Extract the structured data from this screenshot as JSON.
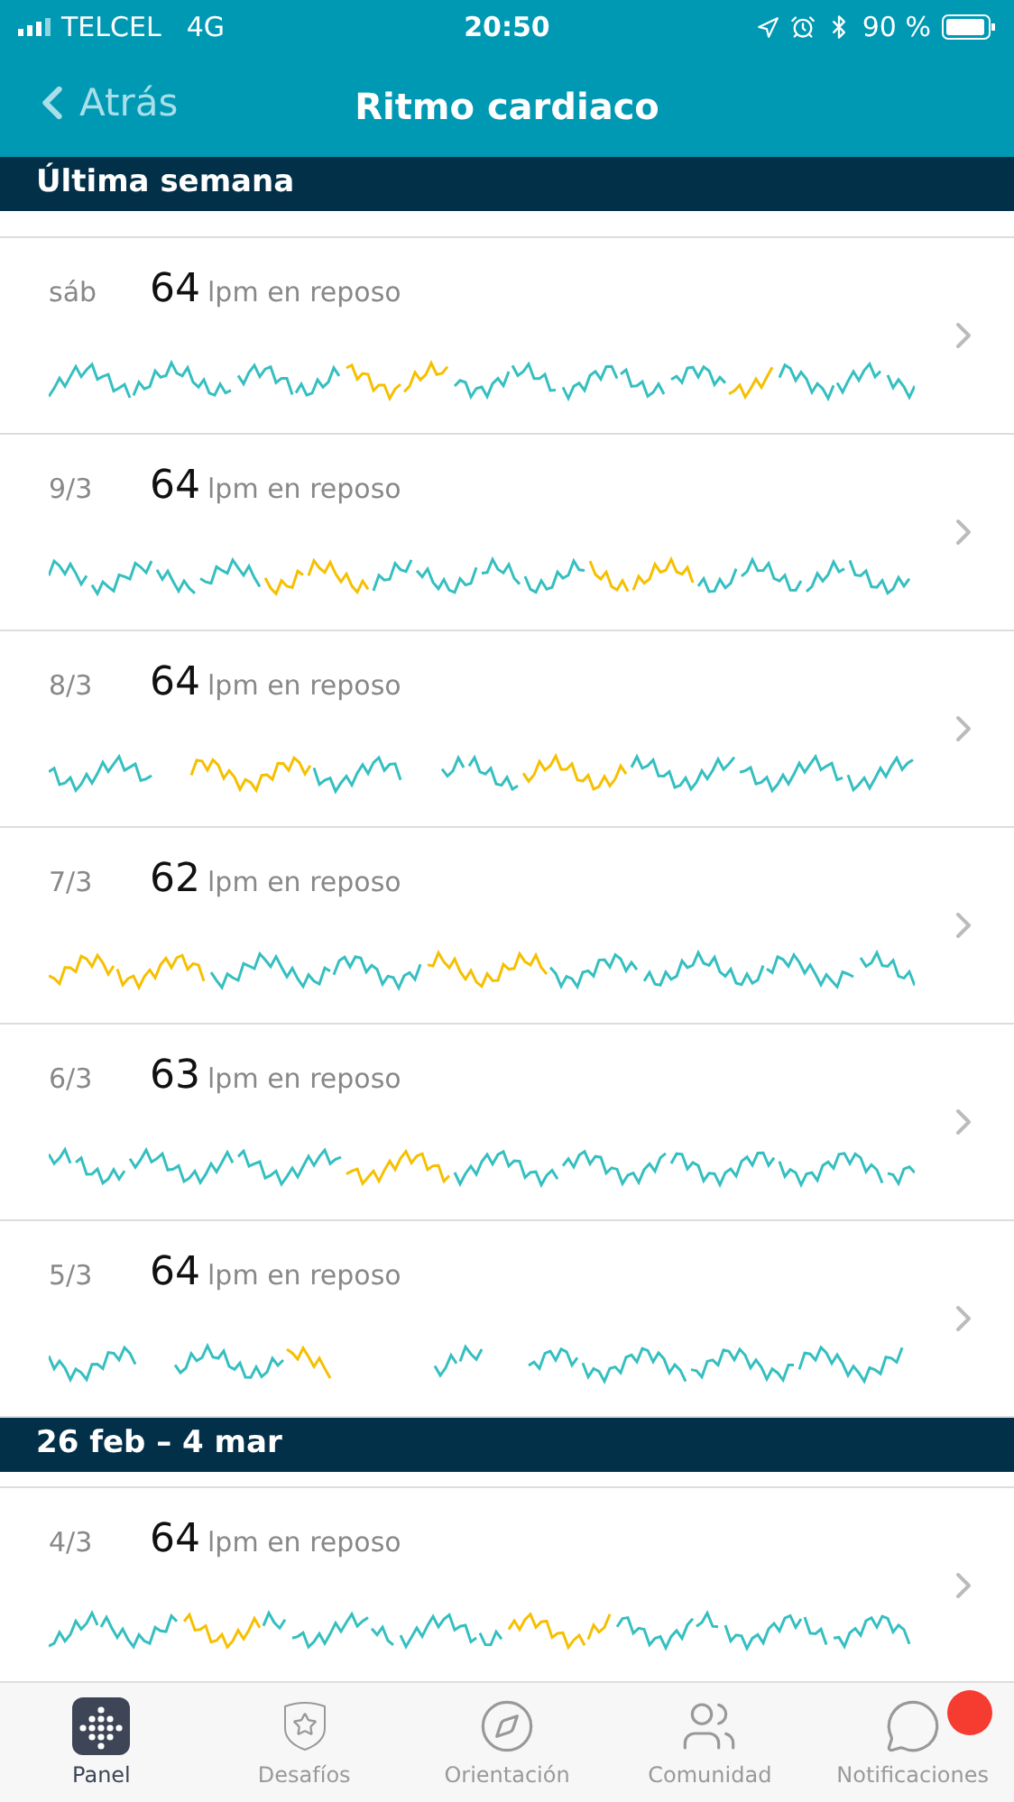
{
  "status_bar": {
    "carrier": "TELCEL",
    "network": "4G",
    "time": "20:50",
    "battery": "90 %"
  },
  "nav": {
    "back": "Atrás",
    "title": "Ritmo cardiaco"
  },
  "sections": [
    {
      "title": "Última semana",
      "days": [
        {
          "date": "sáb",
          "value": "64",
          "unit": "lpm en reposo"
        },
        {
          "date": "9/3",
          "value": "64",
          "unit": "lpm en reposo"
        },
        {
          "date": "8/3",
          "value": "64",
          "unit": "lpm en reposo"
        },
        {
          "date": "7/3",
          "value": "62",
          "unit": "lpm en reposo"
        },
        {
          "date": "6/3",
          "value": "63",
          "unit": "lpm en reposo"
        },
        {
          "date": "5/3",
          "value": "64",
          "unit": "lpm en reposo"
        }
      ]
    },
    {
      "title": "26 feb – 4 mar",
      "days": [
        {
          "date": "4/3",
          "value": "64",
          "unit": "lpm en reposo"
        }
      ]
    }
  ],
  "tabs": [
    {
      "label": "Panel",
      "selected": true
    },
    {
      "label": "Desafíos",
      "selected": false
    },
    {
      "label": "Orientación",
      "selected": false
    },
    {
      "label": "Comunidad",
      "selected": false
    },
    {
      "label": "Notificaciones",
      "selected": false,
      "badge": true
    }
  ]
}
